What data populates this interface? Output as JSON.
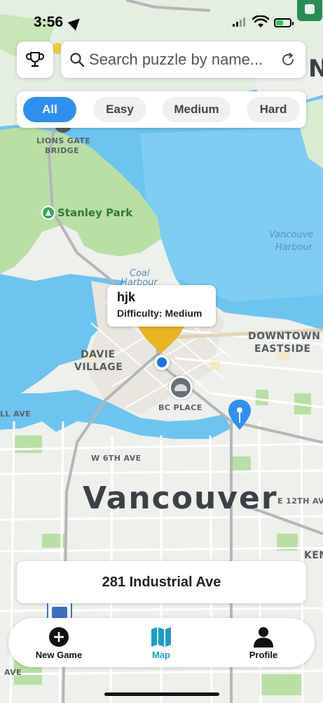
{
  "status_bar": {
    "time": "3:56"
  },
  "map": {
    "labels": {
      "lions_gate_1": "LIONS GATE",
      "lions_gate_2": "BRIDGE",
      "stanley_park": "Stanley Park",
      "coal_harbour_1": "Coal",
      "coal_harbour_2": "Harbour",
      "vancouver_harbour_1": "Vancouve",
      "vancouver_harbour_2": "Harbour",
      "davie_1": "DAVIE",
      "davie_2": "VILLAGE",
      "downtown_1": "DOWNTOWN",
      "downtown_2": "EASTSIDE",
      "bc_place": "BC PLACE",
      "w6th": "W 6TH AVE",
      "ll_ave": "LL AVE",
      "city": "Vancouver",
      "e12th": "E 12TH AV",
      "ken": "KEN",
      "ave_bottom": "AVE",
      "north_letter": "N"
    }
  },
  "search": {
    "placeholder": "Search puzzle by name..."
  },
  "filters": {
    "all": "All",
    "easy": "Easy",
    "medium": "Medium",
    "hard": "Hard"
  },
  "callout": {
    "title": "hjk",
    "subtitle": "Difficulty: Medium"
  },
  "address": {
    "text": "281 Industrial Ave"
  },
  "tabs": {
    "new_game": "New Game",
    "map": "Map",
    "profile": "Profile"
  },
  "colors": {
    "accent": "#2f8ff0",
    "active_tab": "#1a9fc8",
    "marker_gold": "#e8b422",
    "marker_blue": "#2f8ff0",
    "water": "#6cc4ef",
    "park": "#b9dfa5"
  }
}
